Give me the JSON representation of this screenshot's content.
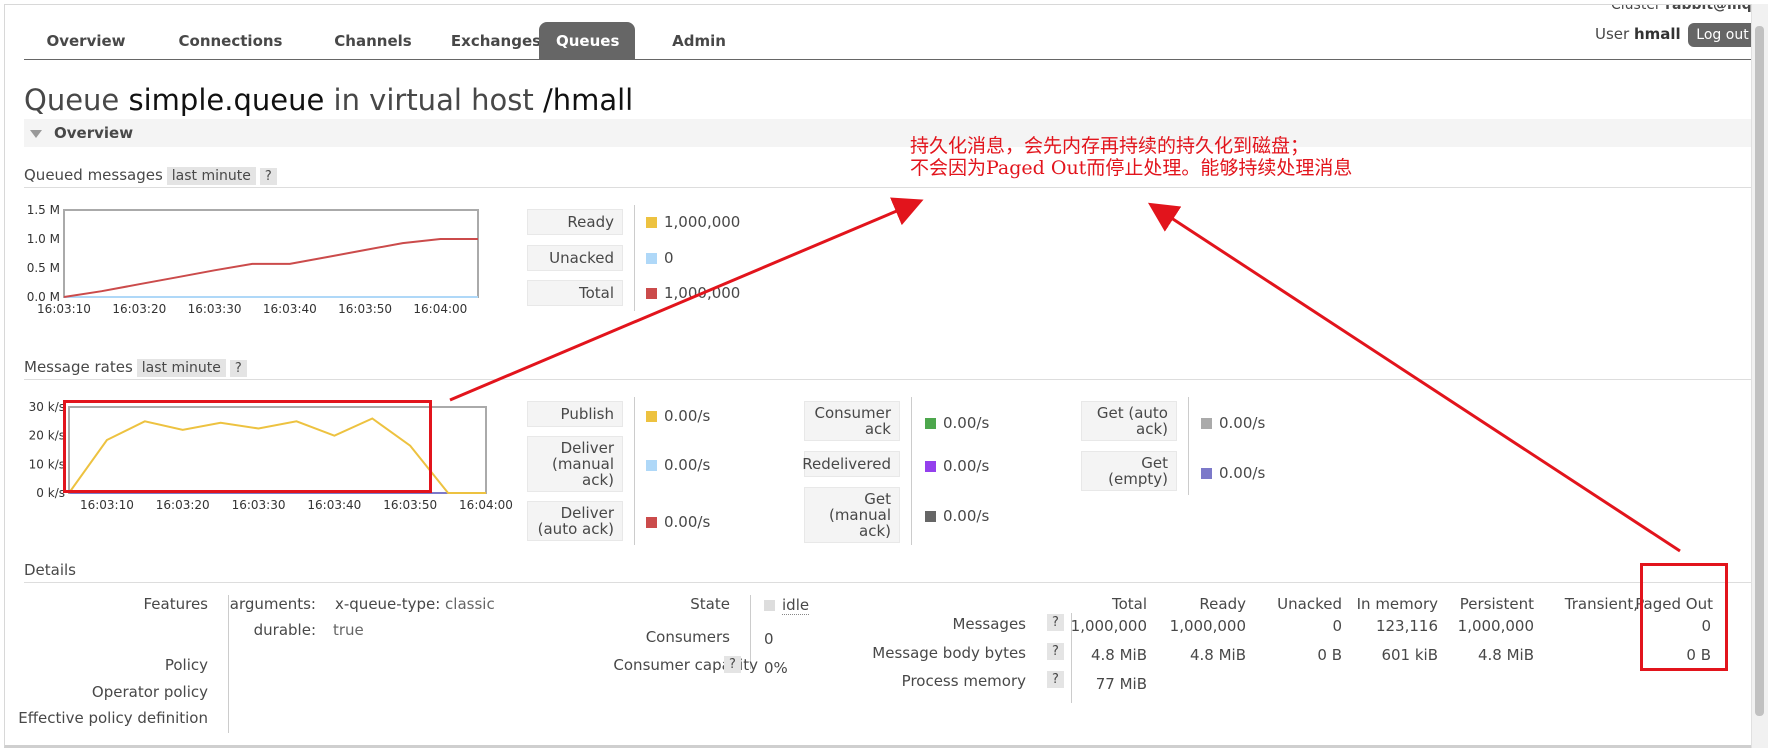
{
  "nav": {
    "tabs": [
      "Overview",
      "Connections",
      "Channels",
      "Exchanges",
      "Queues",
      "Admin"
    ],
    "active": "Queues",
    "cluster_label": "Cluster",
    "cluster_name": "rabbit@mq",
    "user_label": "User",
    "user_name": "hmall",
    "logout_label": "Log out"
  },
  "title": {
    "prefix": "Queue",
    "queue_name": "simple.queue",
    "middle": "in virtual host",
    "vhost": "/hmall"
  },
  "overview_section": {
    "label": "Overview"
  },
  "queued_messages": {
    "label": "Queued messages",
    "range_label": "last minute",
    "help": "?",
    "legend": [
      {
        "label": "Ready",
        "value": "1,000,000",
        "color": "#edc240"
      },
      {
        "label": "Unacked",
        "value": "0",
        "color": "#afd8f8"
      },
      {
        "label": "Total",
        "value": "1,000,000",
        "color": "#cb4b4b"
      }
    ]
  },
  "message_rates": {
    "label": "Message rates",
    "range_label": "last minute",
    "help": "?",
    "col1": [
      {
        "label": "Publish",
        "value": "0.00/s",
        "color": "#edc240"
      },
      {
        "label": "Deliver (manual ack)",
        "value": "0.00/s",
        "color": "#afd8f8"
      },
      {
        "label": "Deliver (auto ack)",
        "value": "0.00/s",
        "color": "#cb4b4b"
      }
    ],
    "col2": [
      {
        "label": "Consumer ack",
        "value": "0.00/s",
        "color": "#4da74d"
      },
      {
        "label": "Redelivered",
        "value": "0.00/s",
        "color": "#9440ed"
      },
      {
        "label": "Get (manual ack)",
        "value": "0.00/s",
        "color": "#666666"
      }
    ],
    "col3": [
      {
        "label": "Get (auto ack)",
        "value": "0.00/s",
        "color": "#aaaaaa"
      },
      {
        "label": "Get (empty)",
        "value": "0.00/s",
        "color": "#7c79c9"
      }
    ]
  },
  "chart_data": [
    {
      "type": "line",
      "x": [
        "16:03:10",
        "16:03:15",
        "16:03:20",
        "16:03:25",
        "16:03:30",
        "16:03:35",
        "16:03:40",
        "16:03:45",
        "16:03:50",
        "16:03:55",
        "16:04:00",
        "16:04:05"
      ],
      "xticks": [
        "16:03:10",
        "16:03:20",
        "16:03:30",
        "16:03:40",
        "16:03:50",
        "16:04:00"
      ],
      "yticks": [
        "1.5 M",
        "1.0 M",
        "0.5 M",
        "0.0 M"
      ],
      "ylim": [
        0,
        1500000
      ],
      "series": [
        {
          "color": "#cb4b4b",
          "values": [
            0,
            100000,
            220000,
            340000,
            460000,
            570000,
            570000,
            690000,
            810000,
            930000,
            1000000,
            1000000
          ]
        },
        {
          "color": "#afd8f8",
          "values": [
            0,
            0,
            0,
            0,
            0,
            0,
            0,
            0,
            0,
            0,
            0,
            0
          ]
        },
        {
          "color": "#edc240",
          "values": [
            0,
            0,
            0,
            0,
            0,
            0,
            0,
            0,
            0,
            0,
            0,
            0
          ]
        }
      ]
    },
    {
      "type": "line",
      "x": [
        "16:03:05",
        "16:03:10",
        "16:03:15",
        "16:03:20",
        "16:03:25",
        "16:03:30",
        "16:03:35",
        "16:03:40",
        "16:03:45",
        "16:03:50",
        "16:03:55",
        "16:04:00"
      ],
      "xticks": [
        "16:03:10",
        "16:03:20",
        "16:03:30",
        "16:03:40",
        "16:03:50",
        "16:04:00"
      ],
      "yticks": [
        "30 k/s",
        "20 k/s",
        "10 k/s",
        "0 k/s"
      ],
      "ylim": [
        0,
        30000
      ],
      "series": [
        {
          "color": "#edc240",
          "values": [
            0,
            18500,
            25000,
            22000,
            24500,
            22500,
            25000,
            20000,
            26000,
            16500,
            0,
            0
          ]
        },
        {
          "color": "#7c79c9",
          "values": [
            0,
            0,
            0,
            0,
            0,
            0,
            0,
            0,
            0,
            0,
            0,
            0
          ]
        }
      ]
    }
  ],
  "details": {
    "label": "Details",
    "features_label": "Features",
    "arguments_label": "arguments:",
    "arg_key": "x-queue-type:",
    "arg_value": "classic",
    "durable_label": "durable:",
    "durable_value": "true",
    "policy_label": "Policy",
    "operator_policy_label": "Operator policy",
    "effective_policy_label": "Effective policy definition",
    "state_label": "State",
    "state_value": "idle",
    "consumers_label": "Consumers",
    "consumers_value": "0",
    "capacity_label": "Consumer capacity",
    "capacity_value": "0%",
    "help": "?",
    "table": {
      "headers": [
        "Total",
        "Ready",
        "Unacked",
        "In memory",
        "Persistent",
        "Transient,",
        "Paged Out"
      ],
      "rows": [
        {
          "label": "Messages",
          "cells": [
            "1,000,000",
            "1,000,000",
            "0",
            "123,116",
            "1,000,000",
            "",
            "0"
          ]
        },
        {
          "label": "Message body bytes",
          "cells": [
            "4.8 MiB",
            "4.8 MiB",
            "0 B",
            "601 kiB",
            "4.8 MiB",
            "",
            "0 B"
          ]
        },
        {
          "label": "Process memory",
          "cells": [
            "77 MiB",
            "",
            "",
            "",
            "",
            "",
            ""
          ]
        }
      ]
    }
  },
  "annotation": {
    "line1": "持久化消息，会先内存再持续的持久化到磁盘；",
    "line2": "不会因为Paged Out而停止处理。能够持续处理消息"
  }
}
